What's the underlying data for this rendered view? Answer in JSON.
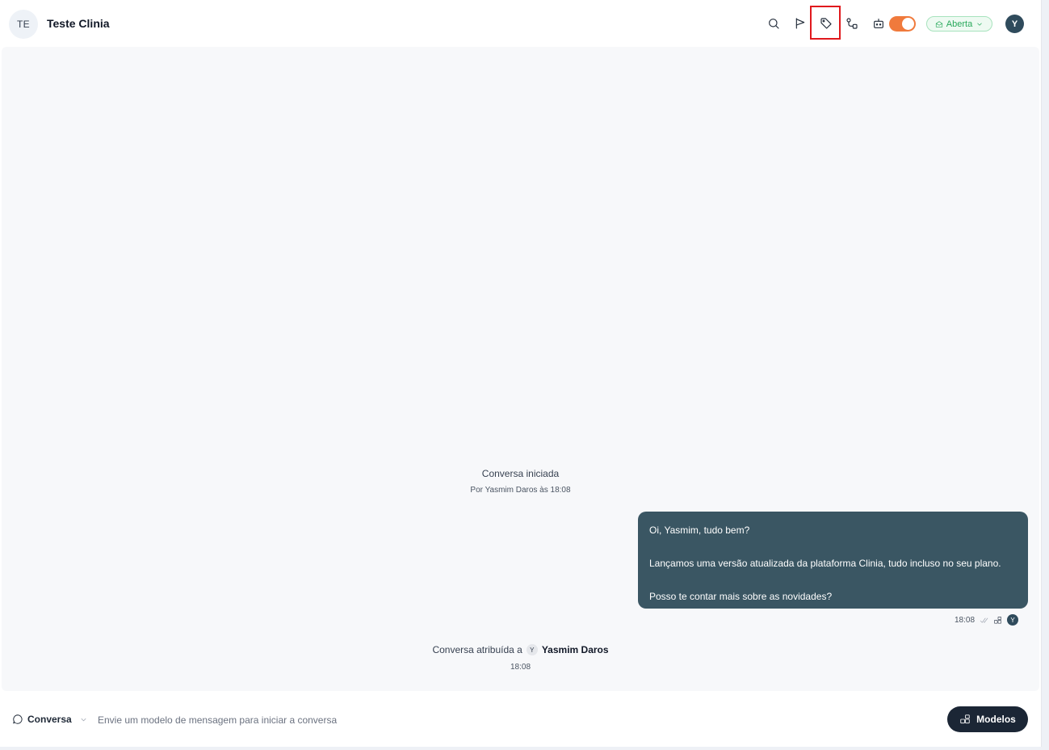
{
  "header": {
    "contact_initials": "TE",
    "contact_name": "Teste Clinia",
    "icons": [
      "search-icon",
      "flag-icon",
      "tag-icon",
      "workflow-icon",
      "bot-icon"
    ],
    "bot_toggle_on": true,
    "status_label": "Aberta",
    "user_initial": "Y"
  },
  "chat": {
    "started_title": "Conversa iniciada",
    "started_sub": "Por Yasmim Daros às 18:08",
    "message": {
      "line1": "Oi, Yasmim, tudo bem?",
      "line2": "Lançamos uma versão atualizada da plataforma Clinia, tudo incluso no seu plano.",
      "line3": "Posso te contar mais sobre as novidades?",
      "time": "18:08",
      "sender_initial": "Y"
    },
    "assigned_prefix": "Conversa atribuída a",
    "assigned_initial": "Y",
    "assigned_name": "Yasmim Daros",
    "assigned_time": "18:08"
  },
  "footer": {
    "channel_label": "Conversa",
    "hint": "Envie um modelo de mensagem para iniciar a conversa",
    "models_label": "Modelos"
  },
  "colors": {
    "bubble": "#3a5663",
    "toggle": "#f07a3c",
    "status_green": "#27a85a",
    "models_button": "#1b2635",
    "highlight": "#e0191d"
  }
}
